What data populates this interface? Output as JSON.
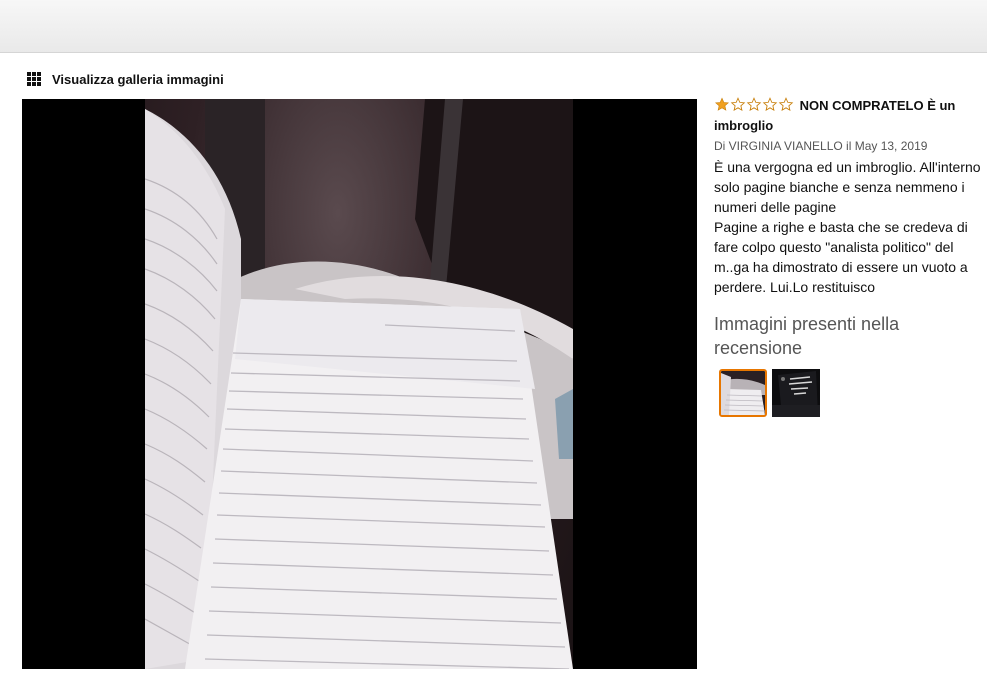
{
  "gallery": {
    "link_label": "Visualizza galleria immagini",
    "icon": "grid-icon"
  },
  "review": {
    "rating": 1,
    "rating_max": 5,
    "star_color": "#f0a020",
    "title": "NON COMPRATELO È un imbroglio",
    "byline": "Di VIRGINIA VIANELLO il May 13, 2019",
    "body_line1": "È una vergogna ed un imbroglio. All'interno solo pagine bianche e senza nemmeno i numeri delle pagine",
    "body_line2": "Pagine a righe e basta che se credeva di fare colpo questo \"analista politico\" del m..ga ha dimostrato di essere un vuoto a perdere. Lui.Lo restituisco",
    "images_heading": "Immagini presenti nella recensione",
    "thumbnails": [
      {
        "selected": true,
        "subject": "open-notebook-photo"
      },
      {
        "selected": false,
        "subject": "book-cover-photo"
      }
    ],
    "thumb_highlight_color": "#e77600"
  }
}
